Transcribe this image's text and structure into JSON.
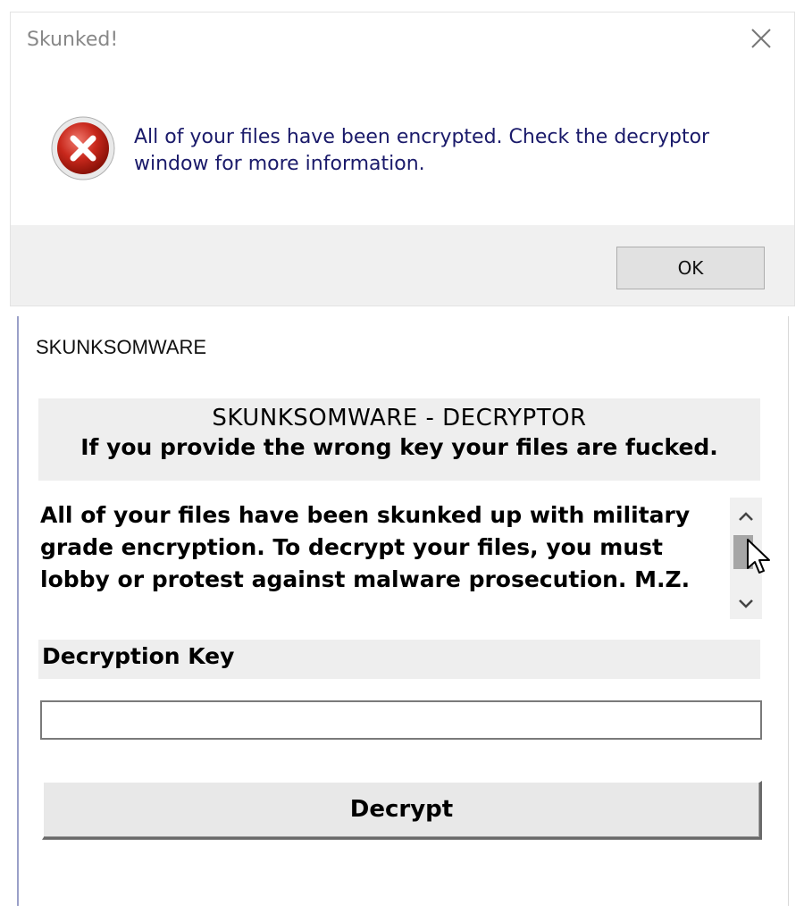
{
  "message_box": {
    "title": "Skunked!",
    "icon": "error-icon",
    "text": "All of your files have been encrypted. Check the decryptor window for more information.",
    "ok_label": "OK"
  },
  "decryptor": {
    "window_title": "SKUNKSOMWARE",
    "banner_title": "SKUNKSOMWARE - DECRYPTOR",
    "banner_warning": "If you provide the wrong key your files are fucked.",
    "message": "All of your files have been skunked up with military grade encryption. To decrypt your files, you must lobby or protest against malware prosecution. M.Z.",
    "key_label": "Decryption Key",
    "key_value": "",
    "decrypt_label": "Decrypt"
  },
  "colors": {
    "error_red": "#c42b1c",
    "footer_gray": "#f0f0f0",
    "banner_gray": "#eeeeee"
  }
}
